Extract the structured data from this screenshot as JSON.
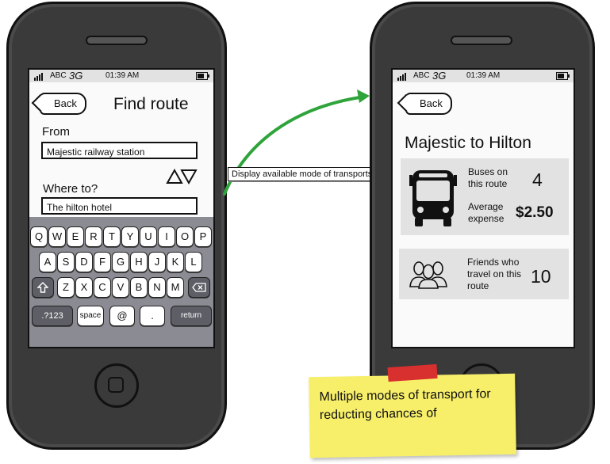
{
  "left_phone": {
    "status": {
      "carrier": "ABC",
      "network": "3G",
      "time": "01:39 AM"
    },
    "back_label": "Back",
    "title": "Find route",
    "from_label": "From",
    "from_value": "Majestic railway station",
    "to_label": "Where to?",
    "to_value": "The hilton hotel",
    "keyboard": {
      "row1": [
        "Q",
        "W",
        "E",
        "R",
        "T",
        "Y",
        "U",
        "I",
        "O",
        "P"
      ],
      "row2": [
        "A",
        "S",
        "D",
        "F",
        "G",
        "H",
        "J",
        "K",
        "L"
      ],
      "row3": [
        "Z",
        "X",
        "C",
        "V",
        "B",
        "N",
        "M"
      ],
      "numbers_label": ".?123",
      "space_label": "space",
      "at_label": "@",
      "dot_label": ".",
      "return_label": "return",
      "shift_icon": "shift-arrow-icon",
      "backspace_icon": "backspace-icon"
    }
  },
  "connector": {
    "label": "Display available mode of transports",
    "color": "#2fa43a"
  },
  "right_phone": {
    "status": {
      "carrier": "ABC",
      "network": "3G",
      "time": "01:39 AM"
    },
    "back_label": "Back",
    "route_title": "Majestic to Hilton",
    "buses_label": "Buses on this route",
    "buses_value": "4",
    "expense_label": "Average expense",
    "expense_value": "$2.50",
    "friends_label": "Friends who travel on this route",
    "friends_value": "10",
    "bus_icon": "bus-icon",
    "friends_icon": "people-icon"
  },
  "sticky_note": {
    "text": "Multiple modes of transport for reducting chances of",
    "color": "#f7ef6a",
    "tape_color": "#d8302f"
  }
}
